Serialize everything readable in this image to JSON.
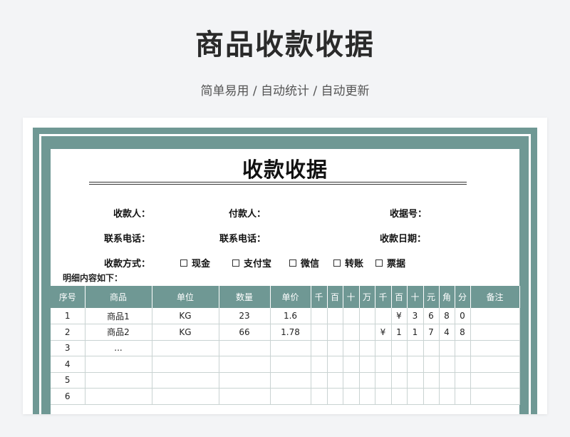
{
  "header": {
    "title": "商品收款收据",
    "subtitle": "简单易用  /  自动统计  /  自动更新"
  },
  "receipt": {
    "title": "收款收据",
    "fields": {
      "payee": "收款人：",
      "payer": "付款人：",
      "receipt_no": "收据号：",
      "phone1": "联系电话：",
      "phone2": "联系电话：",
      "date": "收款日期：",
      "method": "收款方式："
    },
    "payment_options": [
      "现金",
      "支付宝",
      "微信",
      "转账",
      "票据"
    ],
    "details_label": "明细内容如下：",
    "columns": [
      "序号",
      "商品",
      "单位",
      "数量",
      "单价",
      "千",
      "百",
      "十",
      "万",
      "千",
      "百",
      "十",
      "元",
      "角",
      "分",
      "备注"
    ],
    "rows": [
      [
        "1",
        "商品1",
        "KG",
        "23",
        "1.6",
        "",
        "",
        "",
        "",
        "",
        "¥",
        "3",
        "6",
        "8",
        "0",
        ""
      ],
      [
        "2",
        "商品2",
        "KG",
        "66",
        "1.78",
        "",
        "",
        "",
        "",
        "¥",
        "1",
        "1",
        "7",
        "4",
        "8",
        ""
      ],
      [
        "3",
        "...",
        "",
        "",
        "",
        "",
        "",
        "",
        "",
        "",
        "",
        "",
        "",
        "",
        "",
        ""
      ],
      [
        "4",
        "",
        "",
        "",
        "",
        "",
        "",
        "",
        "",
        "",
        "",
        "",
        "",
        "",
        "",
        ""
      ],
      [
        "5",
        "",
        "",
        "",
        "",
        "",
        "",
        "",
        "",
        "",
        "",
        "",
        "",
        "",
        "",
        ""
      ],
      [
        "6",
        "",
        "",
        "",
        "",
        "",
        "",
        "",
        "",
        "",
        "",
        "",
        "",
        "",
        "",
        ""
      ]
    ]
  },
  "colors": {
    "accent": "#6f9894",
    "background": "#f3f4f6"
  }
}
